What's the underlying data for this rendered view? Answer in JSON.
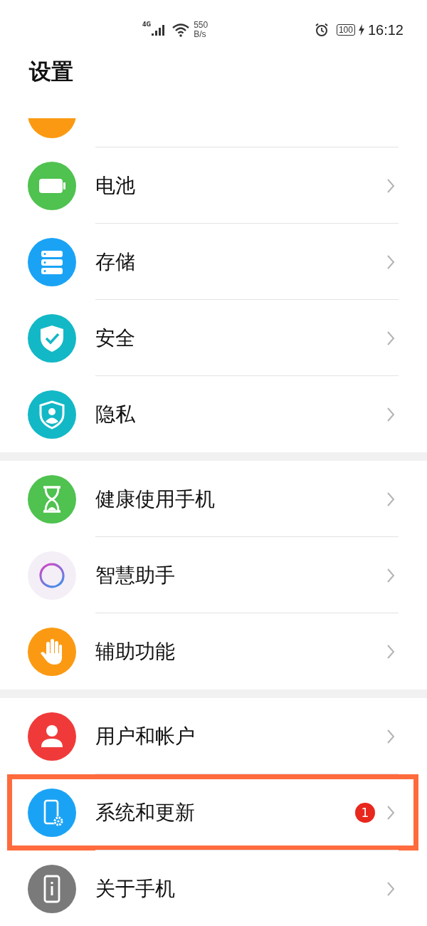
{
  "status_bar": {
    "network": "4G",
    "speed": "550",
    "speed_unit": "B/s",
    "battery": "100",
    "time": "16:12"
  },
  "title": "设置",
  "groups": [
    {
      "items": [
        {
          "kind": "apps",
          "cut_off": true
        },
        {
          "kind": "battery",
          "label": "电池",
          "cut_off": false
        },
        {
          "kind": "storage",
          "label": "存储",
          "cut_off": false
        },
        {
          "kind": "security",
          "label": "安全",
          "cut_off": false
        },
        {
          "kind": "privacy",
          "label": "隐私",
          "cut_off": false
        }
      ]
    },
    {
      "items": [
        {
          "kind": "hourglass",
          "label": "健康使用手机"
        },
        {
          "kind": "assistant",
          "label": "智慧助手"
        },
        {
          "kind": "hand",
          "label": "辅助功能"
        }
      ]
    },
    {
      "items": [
        {
          "kind": "user",
          "label": "用户和帐户",
          "highlighted": false
        },
        {
          "kind": "system",
          "label": "系统和更新",
          "badge": "1",
          "highlighted": true
        },
        {
          "kind": "about",
          "label": "关于手机",
          "highlighted": false
        }
      ]
    }
  ]
}
